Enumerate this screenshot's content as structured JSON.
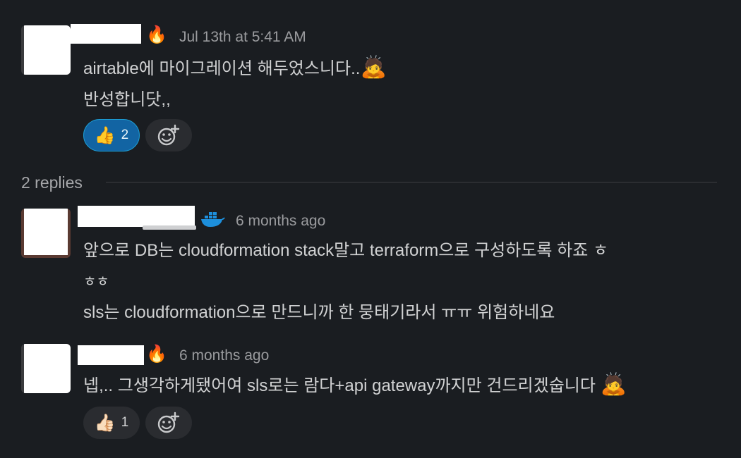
{
  "messages": [
    {
      "status_emoji": "🔥",
      "timestamp": "Jul 13th at 5:41 AM",
      "lines": [
        "airtable에 마이그레이션 해두었스니다..",
        "반성합니닷,,"
      ],
      "inline_emoji": "🙇",
      "reactions": [
        {
          "emoji": "👍",
          "count": "2",
          "active": true
        }
      ]
    }
  ],
  "thread": {
    "replies_label": "2 replies",
    "replies": [
      {
        "status_emoji": "🐳",
        "timestamp": "6 months ago",
        "lines": [
          "앞으로 DB는 cloudformation stack말고 terraform으로 구성하도록 하죠 ㅎ",
          "ㅎㅎ",
          "sls는 cloudformation으로 만드니까 한 뭉태기라서 ㅠㅠ 위험하네요"
        ]
      },
      {
        "status_emoji": "🔥",
        "timestamp": "6 months ago",
        "lines": [
          "넵,.. 그생각하게됐어여 sls로는 람다+api gateway까지만 건드리겠숩니다"
        ],
        "inline_emoji": "🙇",
        "reactions": [
          {
            "emoji": "👍🏻",
            "count": "1",
            "active": false
          }
        ]
      }
    ]
  },
  "icons": {
    "add_reaction": "add-reaction-icon",
    "docker": "docker-whale-icon"
  },
  "colors": {
    "background": "#1a1d21",
    "text": "#d1d2d3",
    "muted": "#9a9b9e",
    "reaction_active_bg": "#1264a3",
    "reaction_active_border": "#1d9bd1",
    "reaction_bg": "#2a2c30",
    "docker_blue": "#1d8fdc"
  }
}
